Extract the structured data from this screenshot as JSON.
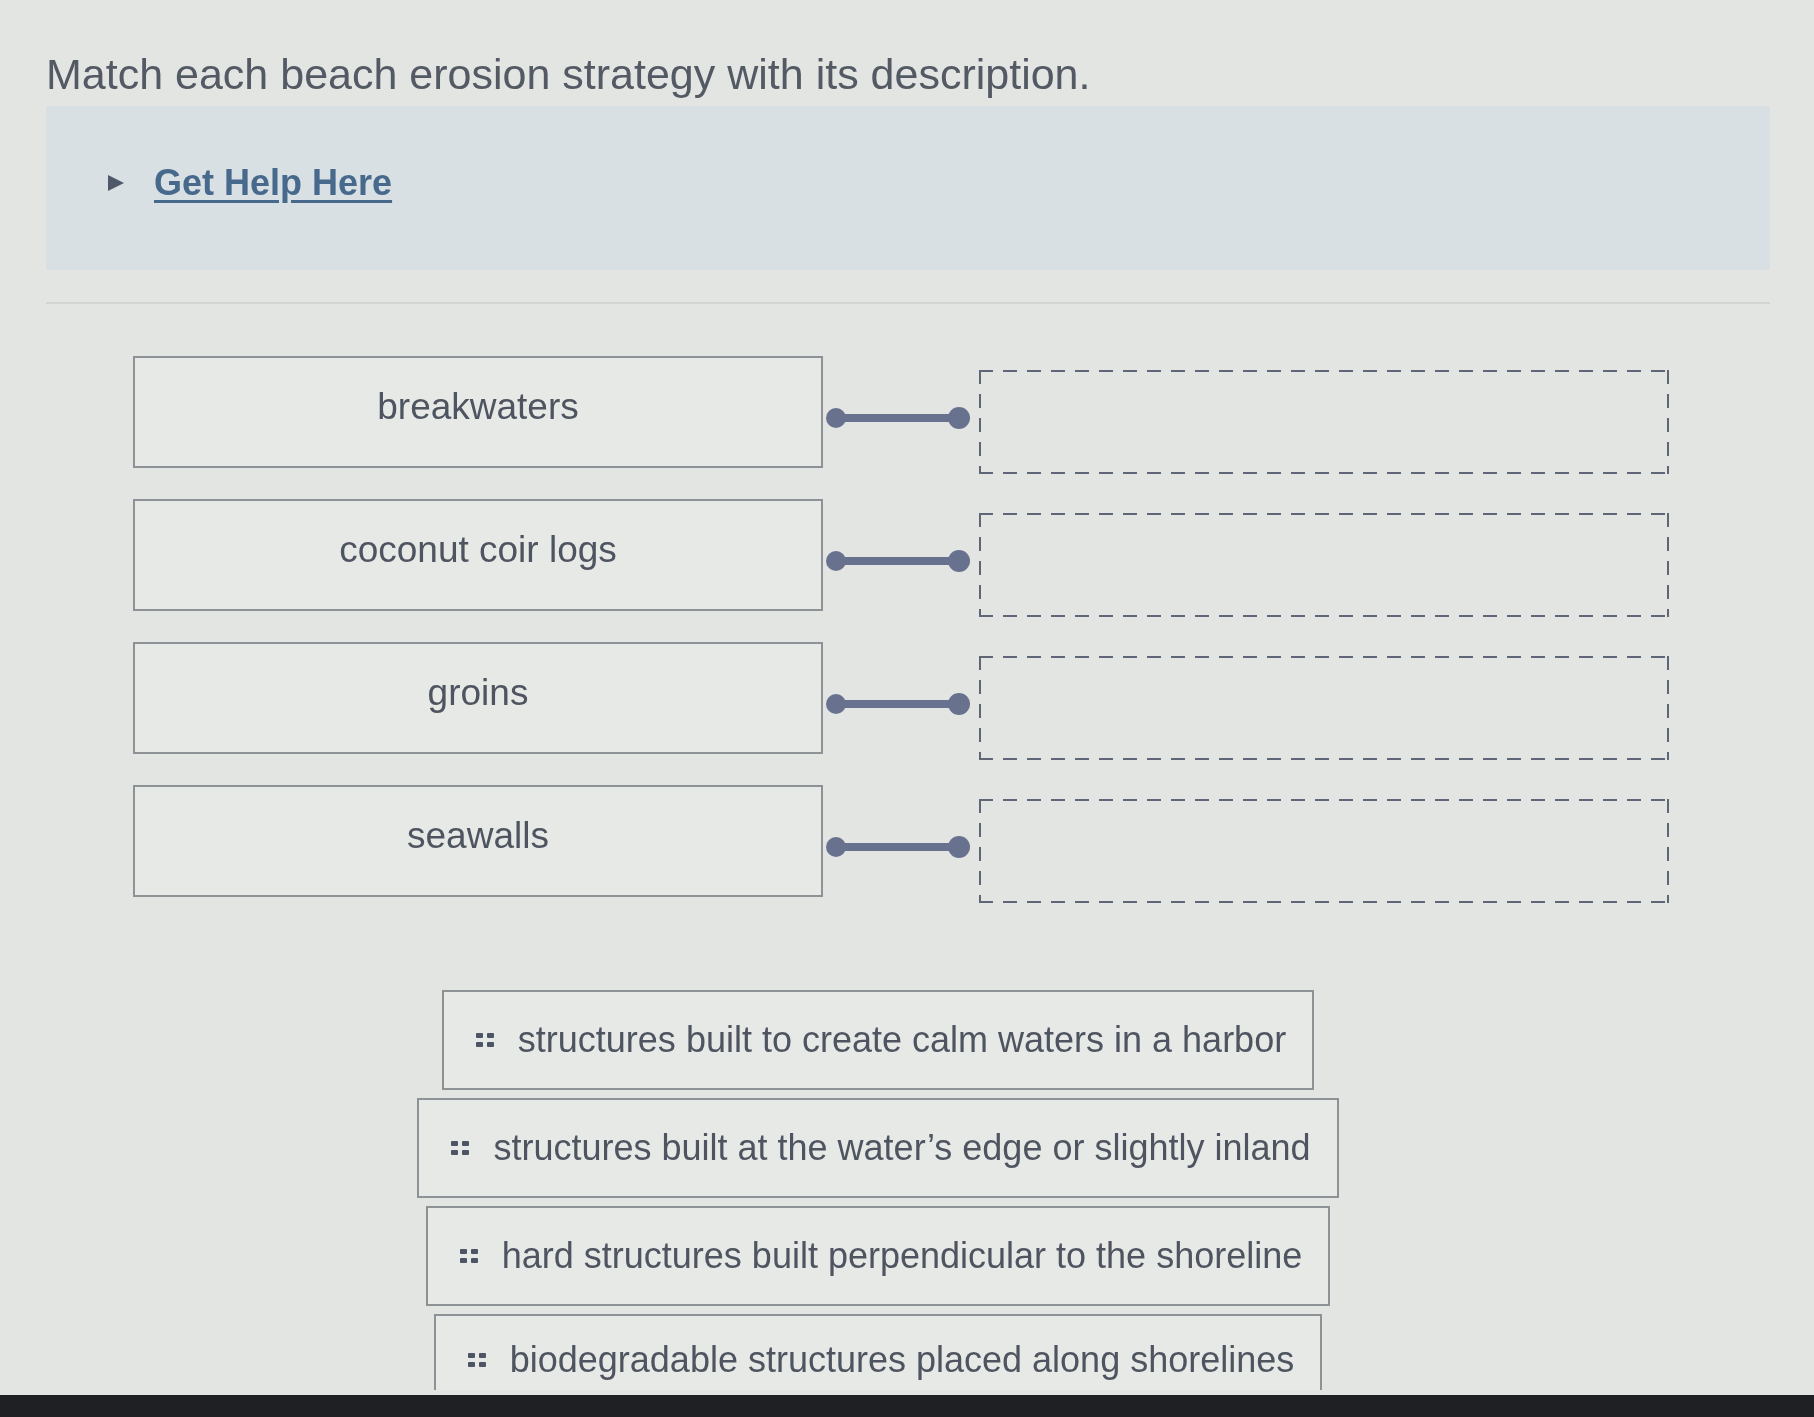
{
  "prompt": {
    "text": "Match each beach erosion strategy with its description."
  },
  "help": {
    "label": "Get Help Here",
    "expanded": false
  },
  "terms": [
    {
      "label": "breakwaters"
    },
    {
      "label": "coconut coir logs"
    },
    {
      "label": "groins"
    },
    {
      "label": "seawalls"
    }
  ],
  "descriptions": [
    {
      "text": "structures built to create calm waters in a harbor"
    },
    {
      "text": "structures built at the water’s edge or slightly inland"
    },
    {
      "text": "hard structures built perpendicular to the shoreline"
    },
    {
      "text": "biodegradable structures placed along shorelines"
    }
  ]
}
